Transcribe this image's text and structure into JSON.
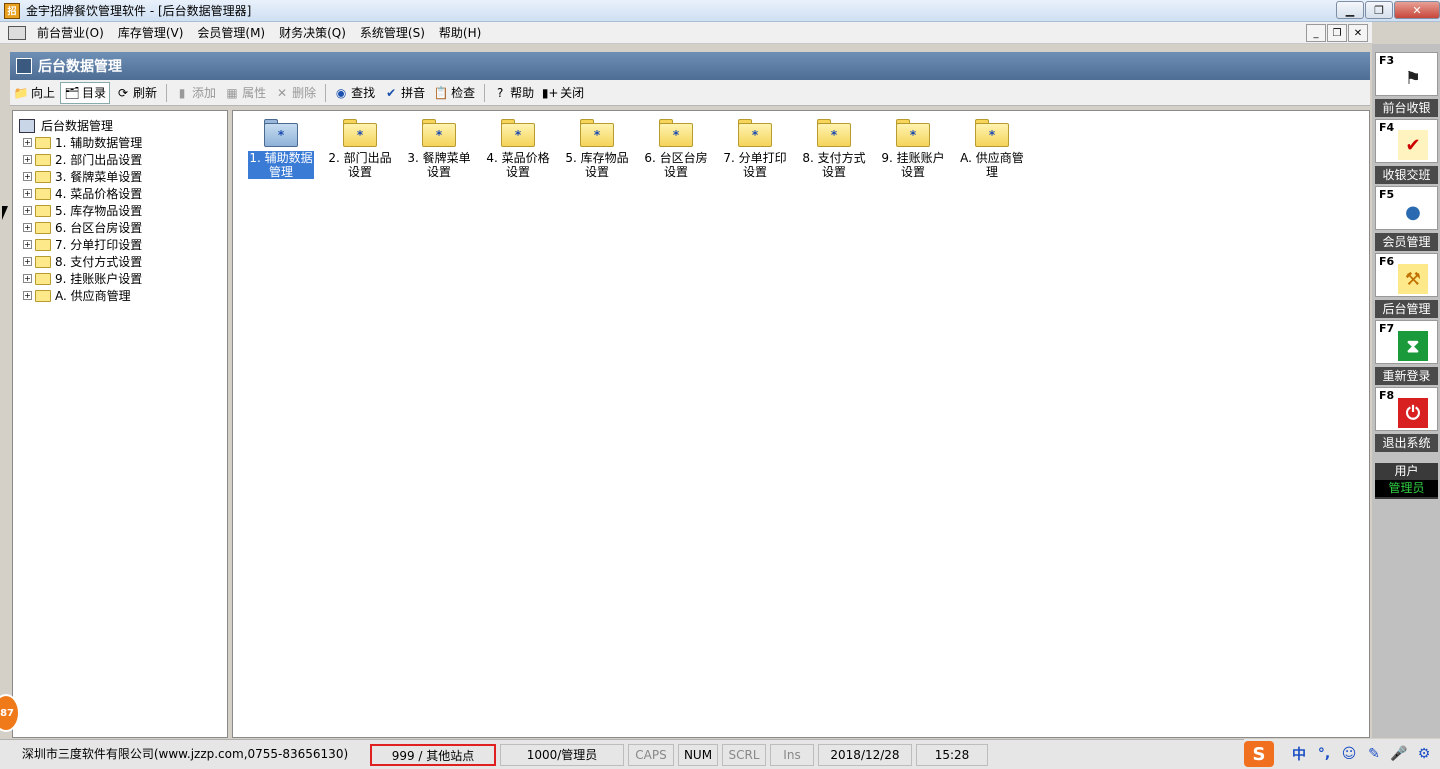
{
  "window": {
    "title": "金宇招牌餐饮管理软件 - [后台数据管理器]"
  },
  "menu": [
    "前台营业(O)",
    "库存管理(V)",
    "会员管理(M)",
    "财务决策(Q)",
    "系统管理(S)",
    "帮助(H)"
  ],
  "panel": {
    "title": "后台数据管理"
  },
  "toolbar": {
    "up": "向上",
    "catalog": "目录",
    "refresh": "刷新",
    "add": "添加",
    "props": "属性",
    "delete": "删除",
    "find": "查找",
    "pinyin": "拼音",
    "check": "检查",
    "help": "帮助",
    "close": "关闭"
  },
  "tree": {
    "root": "后台数据管理",
    "items": [
      "1. 辅助数据管理",
      "2. 部门出品设置",
      "3. 餐牌菜单设置",
      "4. 菜品价格设置",
      "5. 库存物品设置",
      "6. 台区台房设置",
      "7. 分单打印设置",
      "8. 支付方式设置",
      "9. 挂账账户设置",
      "A. 供应商管理"
    ]
  },
  "folders": [
    {
      "line1": "1. 辅助数据",
      "line2": "管理"
    },
    {
      "line1": "2. 部门出品",
      "line2": "设置"
    },
    {
      "line1": "3. 餐牌菜单",
      "line2": "设置"
    },
    {
      "line1": "4. 菜品价格",
      "line2": "设置"
    },
    {
      "line1": "5. 库存物品",
      "line2": "设置"
    },
    {
      "line1": "6. 台区台房",
      "line2": "设置"
    },
    {
      "line1": "7. 分单打印",
      "line2": "设置"
    },
    {
      "line1": "8. 支付方式",
      "line2": "设置"
    },
    {
      "line1": "9. 挂账账户",
      "line2": "设置"
    },
    {
      "line1": "A. 供应商管",
      "line2": "理"
    }
  ],
  "sidebar": {
    "tiles": [
      {
        "key": "F3",
        "label": "前台收银"
      },
      {
        "key": "F4",
        "label": "收银交班"
      },
      {
        "key": "F5",
        "label": "会员管理"
      },
      {
        "key": "F6",
        "label": "后台管理"
      },
      {
        "key": "F7",
        "label": "重新登录"
      },
      {
        "key": "F8",
        "label": "退出系统"
      }
    ],
    "user_label": "用户",
    "user_role": "管理员"
  },
  "status": {
    "company": "深圳市三度软件有限公司(www.jzzp.com,0755-83656130)",
    "station": "999 / 其他站点",
    "user": "1000/管理员",
    "caps": "CAPS",
    "num": "NUM",
    "scrl": "SCRL",
    "ins": "Ins",
    "date": "2018/12/28",
    "time": "15:28"
  },
  "ime": {
    "logo": "S",
    "lang": "中",
    "punct": "°,",
    "emoji": "☺",
    "pen": "✎",
    "mic": "🎤",
    "tools": "⚙"
  },
  "badge": "87",
  "colors": {
    "header": "#5b7aa3",
    "selected": "#3a7bd5",
    "folder": "#f4d45a",
    "sidebar_label": "#4a4a4a",
    "user_role": "#2ecc40",
    "station_border": "#e02020"
  }
}
